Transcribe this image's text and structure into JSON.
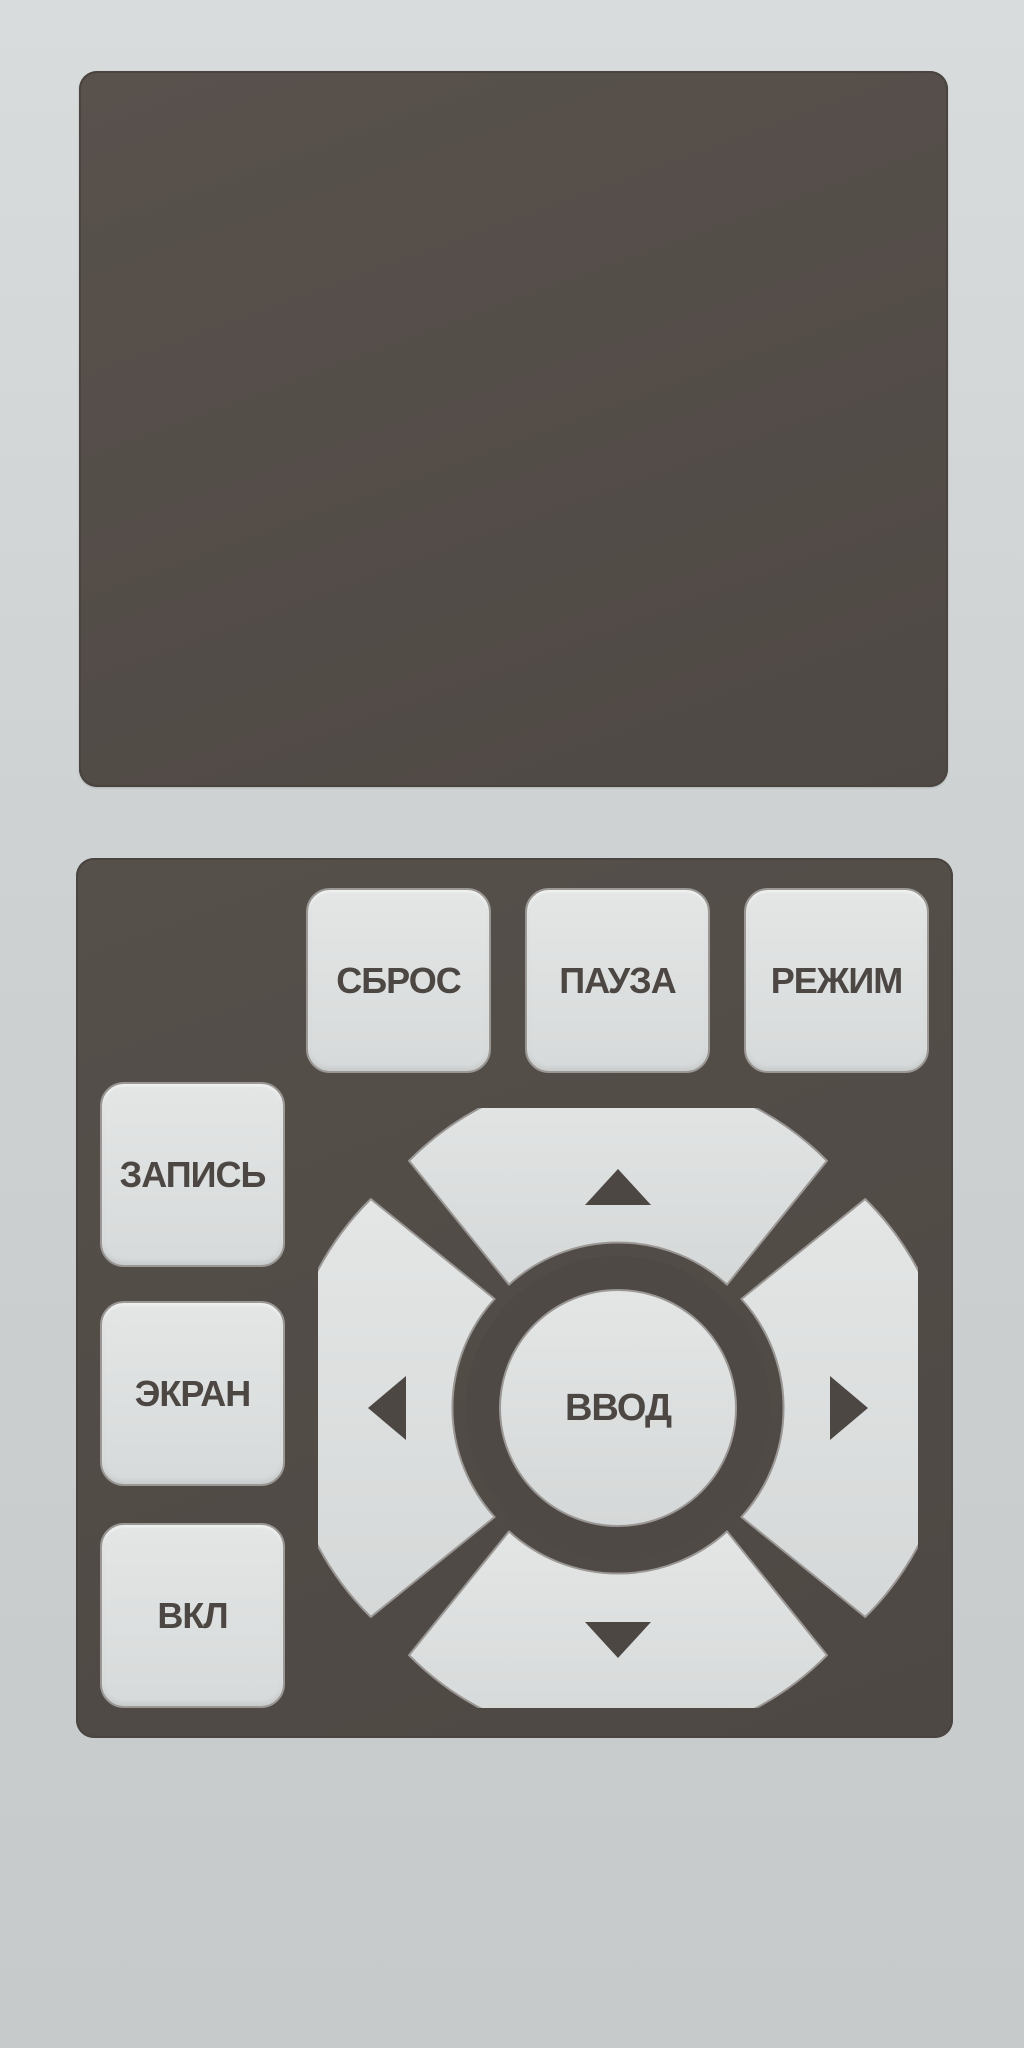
{
  "device": {
    "display": {
      "content": ""
    },
    "keys": {
      "reset": {
        "label": "СБРОС"
      },
      "pause": {
        "label": "ПАУЗА"
      },
      "mode": {
        "label": "РЕЖИМ"
      },
      "record": {
        "label": "ЗАПИСЬ"
      },
      "screen": {
        "label": "ЭКРАН"
      },
      "power": {
        "label": "ВКЛ"
      },
      "enter": {
        "label": "ВВОД"
      }
    },
    "dpad": {
      "up_icon": "triangle-up-icon",
      "down_icon": "triangle-down-icon",
      "left_icon": "triangle-left-icon",
      "right_icon": "triangle-right-icon"
    },
    "colors": {
      "panel": "#524c48",
      "key": "#dcdfdf",
      "label": "#4d4744",
      "background": "#d1d4d4"
    }
  }
}
